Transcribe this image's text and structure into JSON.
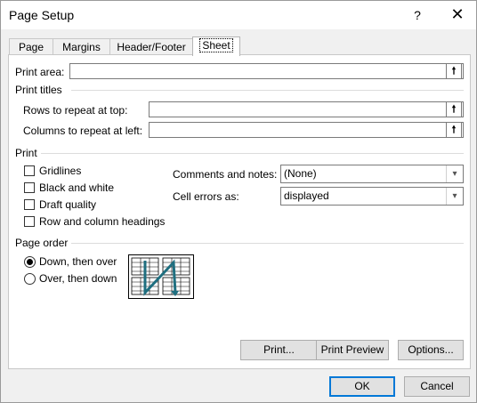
{
  "window": {
    "title": "Page Setup",
    "help": "?",
    "close": "✕"
  },
  "tabs": [
    {
      "label": "Page"
    },
    {
      "label": "Margins"
    },
    {
      "label": "Header/Footer"
    },
    {
      "label": "Sheet",
      "active": true
    }
  ],
  "print_area": {
    "label": "Print area:",
    "value": ""
  },
  "print_titles": {
    "heading": "Print titles",
    "rows_label": "Rows to repeat at top:",
    "rows_value": "",
    "cols_label": "Columns to repeat at left:",
    "cols_value": ""
  },
  "print": {
    "heading": "Print",
    "gridlines": {
      "label": "Gridlines",
      "checked": false
    },
    "black_white": {
      "label": "Black and white",
      "checked": false
    },
    "draft": {
      "label": "Draft quality",
      "checked": false
    },
    "headings": {
      "label": "Row and column headings",
      "checked": false
    },
    "comments_label": "Comments and notes:",
    "comments_value": "(None)",
    "errors_label": "Cell errors as:",
    "errors_value": "displayed"
  },
  "page_order": {
    "heading": "Page order",
    "down_then_over": {
      "label": "Down, then over",
      "selected": true
    },
    "over_then_down": {
      "label": "Over, then down",
      "selected": false
    }
  },
  "buttons": {
    "print": "Print...",
    "print_preview": "Print Preview",
    "options": "Options...",
    "ok": "OK",
    "cancel": "Cancel"
  },
  "colors": {
    "accent": "#0078d7",
    "arrow": "#1f6f80"
  },
  "icons": {
    "ref_button": "collapse-dialog-icon"
  }
}
